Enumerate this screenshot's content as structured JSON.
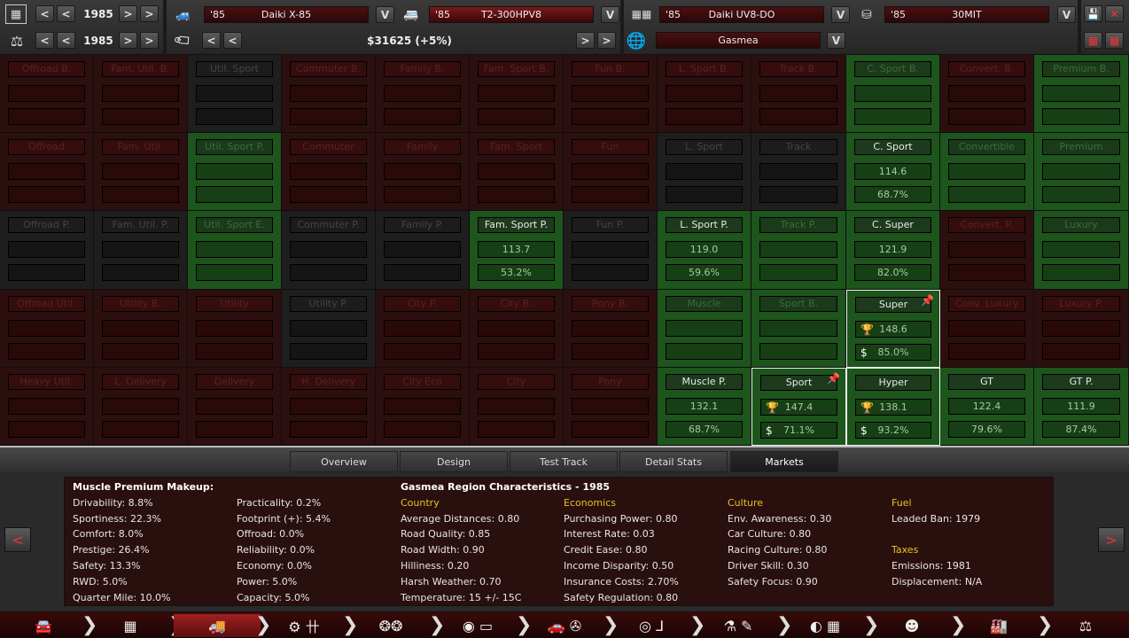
{
  "top": {
    "row1": {
      "calendar_icon": "calendar-icon",
      "year": "1985",
      "car_icon": "car-icon",
      "car_model": {
        "year": "'85",
        "name": "Daiki X-85"
      },
      "trim_icon": "trim-car-icon",
      "trim": {
        "year": "'85",
        "name": "T2-300HPV8"
      },
      "engine_icon": "engine-icon",
      "engine": {
        "year": "'85",
        "name": "Daiki UV8-DO"
      },
      "engine_variant_icon": "engine-variant-icon",
      "variant": {
        "year": "'85",
        "name": "30MIT"
      }
    },
    "row2": {
      "scale_icon": "scale-icon",
      "year": "1985",
      "price_tag_icon": "price-tag-icon",
      "price": "$31625 (+5%)",
      "globe_icon": "globe-icon",
      "region": "Gasmea"
    },
    "labels": {
      "prev": "<",
      "next": ">",
      "dropdown": "V",
      "save": "💾",
      "close": "✕",
      "grid": "▦"
    }
  },
  "grid": {
    "rows": [
      [
        {
          "title": "Offroad B.",
          "state": "red"
        },
        {
          "title": "Fam. Util. B.",
          "state": "red"
        },
        {
          "title": "Util. Sport",
          "state": "dark"
        },
        {
          "title": "Commuter B.",
          "state": "red"
        },
        {
          "title": "Family B.",
          "state": "red"
        },
        {
          "title": "Fam. Sport B.",
          "state": "red"
        },
        {
          "title": "Fun B.",
          "state": "red"
        },
        {
          "title": "L. Sport B.",
          "state": "red"
        },
        {
          "title": "Track B.",
          "state": "red"
        },
        {
          "title": "C. Sport B.",
          "state": "green"
        },
        {
          "title": "Convert. B.",
          "state": "red"
        },
        {
          "title": "Premium B.",
          "state": "green"
        }
      ],
      [
        {
          "title": "Offroad",
          "state": "red"
        },
        {
          "title": "Fam. Util.",
          "state": "red"
        },
        {
          "title": "Util. Sport P.",
          "state": "green"
        },
        {
          "title": "Commuter",
          "state": "red"
        },
        {
          "title": "Family",
          "state": "red"
        },
        {
          "title": "Fam. Sport",
          "state": "red"
        },
        {
          "title": "Fun",
          "state": "red"
        },
        {
          "title": "L. Sport",
          "state": "dark"
        },
        {
          "title": "Track",
          "state": "dark"
        },
        {
          "title": "C. Sport",
          "state": "green",
          "active": true,
          "v1": "114.6",
          "v2": "68.7%"
        },
        {
          "title": "Convertible",
          "state": "green"
        },
        {
          "title": "Premium",
          "state": "green"
        }
      ],
      [
        {
          "title": "Offroad P.",
          "state": "dark"
        },
        {
          "title": "Fam. Util. P.",
          "state": "dark"
        },
        {
          "title": "Util. Sport E.",
          "state": "green"
        },
        {
          "title": "Commuter P.",
          "state": "dark"
        },
        {
          "title": "Family P.",
          "state": "dark"
        },
        {
          "title": "Fam. Sport P.",
          "state": "green",
          "active": true,
          "v1": "113.7",
          "v2": "53.2%"
        },
        {
          "title": "Fun P.",
          "state": "dark"
        },
        {
          "title": "L. Sport P.",
          "state": "green",
          "active": true,
          "v1": "119.0",
          "v2": "59.6%"
        },
        {
          "title": "Track P.",
          "state": "green"
        },
        {
          "title": "C. Super",
          "state": "green",
          "active": true,
          "v1": "121.9",
          "v2": "82.0%"
        },
        {
          "title": "Convert. P.",
          "state": "red"
        },
        {
          "title": "Luxury",
          "state": "green"
        }
      ],
      [
        {
          "title": "Offroad Util.",
          "state": "red"
        },
        {
          "title": "Utility B.",
          "state": "red"
        },
        {
          "title": "Utility",
          "state": "red"
        },
        {
          "title": "Utility P.",
          "state": "dark"
        },
        {
          "title": "City P.",
          "state": "red"
        },
        {
          "title": "City B.",
          "state": "red"
        },
        {
          "title": "Pony B.",
          "state": "red"
        },
        {
          "title": "Muscle",
          "state": "green"
        },
        {
          "title": "Sport B.",
          "state": "green"
        },
        {
          "title": "Super",
          "state": "green",
          "active": true,
          "hl": true,
          "pin": true,
          "icons": true,
          "v1": "148.6",
          "v2": "85.0%"
        },
        {
          "title": "Conv. Luxury",
          "state": "red"
        },
        {
          "title": "Luxury P.",
          "state": "red"
        }
      ],
      [
        {
          "title": "Heavy Util.",
          "state": "red"
        },
        {
          "title": "L. Delivery",
          "state": "red"
        },
        {
          "title": "Delivery",
          "state": "red"
        },
        {
          "title": "H. Delivery",
          "state": "red"
        },
        {
          "title": "City Eco",
          "state": "red"
        },
        {
          "title": "City",
          "state": "red"
        },
        {
          "title": "Pony",
          "state": "red"
        },
        {
          "title": "Muscle P.",
          "state": "green",
          "active": true,
          "v1": "132.1",
          "v2": "68.7%"
        },
        {
          "title": "Sport",
          "state": "green",
          "active": true,
          "hl": true,
          "pin": true,
          "icons": true,
          "v1": "147.4",
          "v2": "71.1%"
        },
        {
          "title": "Hyper",
          "state": "green",
          "active": true,
          "hl": true,
          "icons": true,
          "v1": "138.1",
          "v2": "93.2%"
        },
        {
          "title": "GT",
          "state": "green",
          "active": true,
          "v1": "122.4",
          "v2": "79.6%"
        },
        {
          "title": "GT P.",
          "state": "green",
          "active": true,
          "v1": "111.9",
          "v2": "87.4%"
        }
      ]
    ],
    "icons": {
      "trophy": "trophy-icon",
      "dollar": "dollar-icon",
      "pin": "pin-icon"
    }
  },
  "tabs": [
    {
      "label": "Overview",
      "active": false
    },
    {
      "label": "Design",
      "active": false
    },
    {
      "label": "Test Track",
      "active": false
    },
    {
      "label": "Detail Stats",
      "active": false
    },
    {
      "label": "Markets",
      "active": true
    }
  ],
  "info": {
    "makeup": {
      "title": "Muscle Premium Makeup:",
      "col1": [
        "Drivability: 8.8%",
        "Sportiness: 22.3%",
        "Comfort: 8.0%",
        "Prestige: 26.4%",
        "Safety: 13.3%",
        "RWD: 5.0%",
        "Quarter Mile: 10.0%"
      ],
      "col2": [
        "Practicality: 0.2%",
        "Footprint (+): 5.4%",
        "Offroad: 0.0%",
        "Reliability: 0.0%",
        "Economy: 0.0%",
        "Power: 5.0%",
        "Capacity: 5.0%"
      ]
    },
    "region": {
      "title": "Gasmea Region Characteristics - 1985",
      "country": {
        "heading": "Country",
        "items": [
          "Average Distances:  0.80",
          "Road Quality:  0.85",
          "Road Width:  0.90",
          "Hilliness:  0.20",
          "Harsh Weather:  0.70",
          "Temperature:  15 +/- 15C"
        ]
      },
      "economics": {
        "heading": "Economics",
        "items": [
          "Purchasing Power:  0.80",
          "Interest Rate:  0.03",
          "Credit Ease:  0.80",
          "Income Disparity:  0.50",
          "Insurance Costs:  2.70%",
          "Safety Regulation:  0.80"
        ]
      },
      "culture": {
        "heading": "Culture",
        "items": [
          "Env. Awareness:  0.30",
          "Car Culture:  0.80",
          "Racing Culture:  0.80",
          "Driver Skill:  0.30",
          "Safety Focus:  0.90"
        ]
      },
      "fuel": {
        "heading": "Fuel",
        "items": [
          "Leaded Ban:  1979"
        ]
      },
      "taxes": {
        "heading": "Taxes",
        "items": [
          "Emissions:  1981",
          "Displacement: N/A"
        ]
      }
    },
    "nav_prev": "<",
    "nav_next": ">"
  },
  "bottombar": {
    "items": [
      {
        "name": "car-model-icon",
        "glyph": "🚘",
        "active": false
      },
      {
        "name": "engine-block-icon",
        "glyph": "▦",
        "active": false
      },
      {
        "name": "trim-icon",
        "glyph": "🚚",
        "active": true
      },
      {
        "name": "gearbox-icon",
        "glyph": "⚙ 卄",
        "active": false
      },
      {
        "name": "suspension-icon",
        "glyph": "❂❂",
        "active": false
      },
      {
        "name": "chassis-icon",
        "glyph": "◉ ▭",
        "active": false
      },
      {
        "name": "aero-icon",
        "glyph": "🚗 ✇",
        "active": false
      },
      {
        "name": "interior-icon",
        "glyph": "◎ ⅃",
        "active": false
      },
      {
        "name": "testing-icon",
        "glyph": "⚗ ✎",
        "active": false
      },
      {
        "name": "track-icon",
        "glyph": "◐ ▦",
        "active": false
      },
      {
        "name": "engineer-icon",
        "glyph": "☻",
        "active": false
      },
      {
        "name": "factory-icon",
        "glyph": "🏭",
        "active": false
      },
      {
        "name": "balance-icon",
        "glyph": "⚖",
        "active": false
      }
    ]
  }
}
